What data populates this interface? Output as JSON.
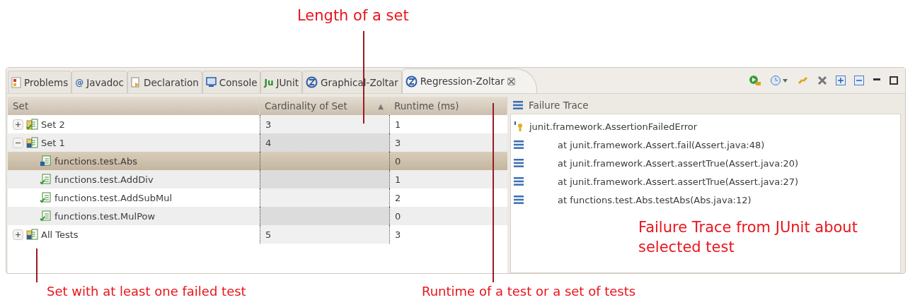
{
  "annotations": {
    "top": "Length of a set",
    "trace": "Failure Trace from JUnit about selected test",
    "bottom_left": "Set with at least one failed test",
    "bottom_right": "Runtime of a test or a set of tests"
  },
  "tabs": [
    {
      "label": "Problems",
      "kind": "problems",
      "selected": false
    },
    {
      "label": "Javadoc",
      "kind": "glyph",
      "glyph": "@",
      "selected": false
    },
    {
      "label": "Declaration",
      "kind": "declaration",
      "selected": false
    },
    {
      "label": "Console",
      "kind": "console",
      "selected": false
    },
    {
      "label": "JUnit",
      "kind": "glyph",
      "glyph": "Ju",
      "selected": false
    },
    {
      "label": "Graphical-Zoltar",
      "kind": "zoltar",
      "selected": false
    },
    {
      "label": "Regression-Zoltar",
      "kind": "zoltar",
      "selected": true,
      "closable": true
    }
  ],
  "table": {
    "columns": [
      {
        "label": "Set"
      },
      {
        "label": "Cardinality of Set",
        "sort_mark": "▲"
      },
      {
        "label": "Runtime (ms)"
      }
    ],
    "rows": [
      {
        "label": "Set 2",
        "failed": false,
        "cardinality": "3",
        "runtime": "1",
        "expanded": false,
        "selected": false
      },
      {
        "label": "Set 1",
        "failed": true,
        "cardinality": "4",
        "runtime": "3",
        "expanded": true,
        "selected": false,
        "children": [
          {
            "label": "functions.test.Abs",
            "failed": true,
            "runtime": "0",
            "selected": true
          },
          {
            "label": "functions.test.AddDiv",
            "failed": false,
            "runtime": "1",
            "selected": false
          },
          {
            "label": "functions.test.AddSubMul",
            "failed": false,
            "runtime": "2",
            "selected": false
          },
          {
            "label": "functions.test.MulPow",
            "failed": false,
            "runtime": "0",
            "selected": false
          }
        ]
      },
      {
        "label": "All Tests",
        "failed": true,
        "cardinality": "5",
        "runtime": "3",
        "expanded": false,
        "selected": false
      }
    ]
  },
  "trace": {
    "title": "Failure Trace",
    "lines": [
      {
        "kind": "error",
        "text": "junit.framework.AssertionFailedError"
      },
      {
        "kind": "frame",
        "text": "at junit.framework.Assert.fail(Assert.java:48)"
      },
      {
        "kind": "frame",
        "text": "at junit.framework.Assert.assertTrue(Assert.java:20)"
      },
      {
        "kind": "frame",
        "text": "at junit.framework.Assert.assertTrue(Assert.java:27)"
      },
      {
        "kind": "frame",
        "text": "at functions.test.Abs.testAbs(Abs.java:12)"
      }
    ]
  }
}
